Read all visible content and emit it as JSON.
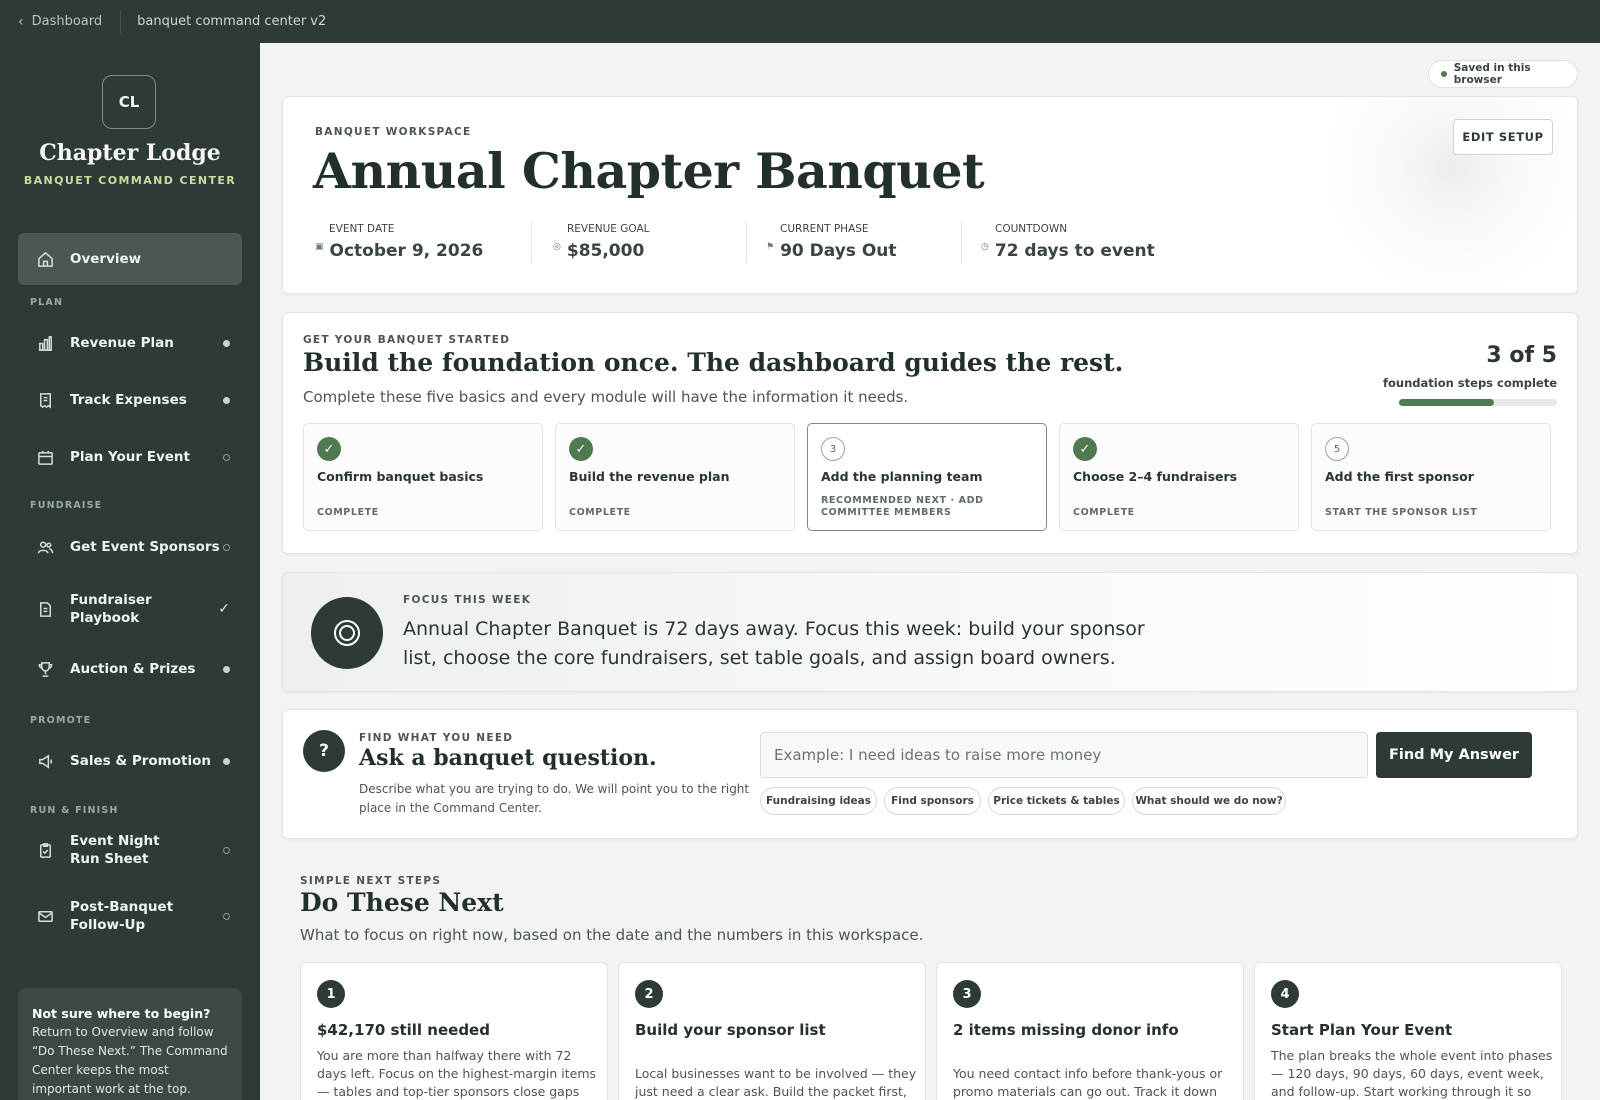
{
  "topbar": {
    "back_label": "Dashboard",
    "breadcrumb": "banquet command center v2"
  },
  "sidebar": {
    "initials": "CL",
    "org_name": "Chapter Lodge",
    "subtitle": "BANQUET COMMAND CENTER",
    "overview": "Overview",
    "sections": {
      "plan": "PLAN",
      "fundraise": "FUNDRAISE",
      "promote": "PROMOTE",
      "run": "RUN & FINISH"
    },
    "items": [
      {
        "label": "Revenue Plan",
        "status": "filled"
      },
      {
        "label": "Track Expenses",
        "status": "filled"
      },
      {
        "label": "Plan Your Event",
        "status": "hollow"
      },
      {
        "label": "Get Event Sponsors",
        "status": "hollow"
      },
      {
        "label": "Fundraiser Playbook",
        "status": "check"
      },
      {
        "label": "Auction & Prizes",
        "status": "filled"
      },
      {
        "label": "Sales & Promotion",
        "status": "filled"
      },
      {
        "label": "Event Night Run Sheet",
        "status": "hollow"
      },
      {
        "label": "Post-Banquet Follow-Up",
        "status": "hollow"
      }
    ],
    "help": {
      "title": "Not sure where to begin?",
      "body": "Return to Overview and follow “Do These Next.” The Command Center keeps the most important work at the top."
    }
  },
  "saved_status": "Saved in this browser",
  "hero": {
    "eyebrow": "BANQUET WORKSPACE",
    "title": "Annual Chapter Banquet",
    "edit_label": "EDIT SETUP",
    "meta": [
      {
        "label": "EVENT DATE",
        "value": "October 9, 2026"
      },
      {
        "label": "REVENUE GOAL",
        "value": "$85,000"
      },
      {
        "label": "CURRENT PHASE",
        "value": "90 Days Out"
      },
      {
        "label": "COUNTDOWN",
        "value": "72 days to event"
      }
    ]
  },
  "foundation": {
    "eyebrow": "GET YOUR BANQUET STARTED",
    "title": "Build the foundation once. The dashboard guides the rest.",
    "subtitle": "Complete these five basics and every module will have the information it needs.",
    "progress_text": "3 of 5",
    "progress_caption": "foundation steps complete",
    "progress_fraction": 0.6,
    "steps": [
      {
        "num": "✓",
        "title": "Confirm banquet basics",
        "status": "COMPLETE",
        "state": "done"
      },
      {
        "num": "✓",
        "title": "Build the revenue plan",
        "status": "COMPLETE",
        "state": "done"
      },
      {
        "num": "3",
        "title": "Add the planning team",
        "status": "RECOMMENDED NEXT · ADD COMMITTEE MEMBERS",
        "state": "rec"
      },
      {
        "num": "✓",
        "title": "Choose 2–4 fundraisers",
        "status": "COMPLETE",
        "state": "done"
      },
      {
        "num": "5",
        "title": "Add the first sponsor",
        "status": "START THE SPONSOR LIST",
        "state": "todo"
      }
    ]
  },
  "focus": {
    "eyebrow": "FOCUS THIS WEEK",
    "text": "Annual Chapter Banquet is 72 days away. Focus this week: build your sponsor list, choose the core fundraisers, set table goals, and assign board owners."
  },
  "ask": {
    "icon": "?",
    "eyebrow": "FIND WHAT YOU NEED",
    "title": "Ask a banquet question.",
    "desc": "Describe what you are trying to do. We will point you to the right place in the Command Center.",
    "placeholder": "Example: I need ideas to raise more money",
    "button": "Find My Answer",
    "chips": [
      "Fundraising ideas",
      "Find sponsors",
      "Price tickets & tables",
      "What should we do now?"
    ]
  },
  "next": {
    "eyebrow": "SIMPLE NEXT STEPS",
    "title": "Do These Next",
    "subtitle": "What to focus on right now, based on the date and the numbers in this workspace.",
    "cards": [
      {
        "num": "1",
        "title": "$42,170 still needed",
        "desc": "You are more than halfway there with 72 days left. Focus on the highest-margin items — tables and top-tier sponsors close gaps"
      },
      {
        "num": "2",
        "title": "Build your sponsor list",
        "desc": "Local businesses want to be involved — they just need a clear ask. Build the packet first,"
      },
      {
        "num": "3",
        "title": "2 items missing donor info",
        "desc": "You need contact info before thank-yous or promo materials can go out. Track it down"
      },
      {
        "num": "4",
        "title": "Start Plan Your Event",
        "desc": "The plan breaks the whole event into phases — 120 days, 90 days, 60 days, event week, and follow-up. Start working through it so"
      }
    ]
  },
  "colors": {
    "sidebar": "#2d3a37",
    "accent_green": "#4f7a4f",
    "brand_sub": "#c9dd9e"
  }
}
